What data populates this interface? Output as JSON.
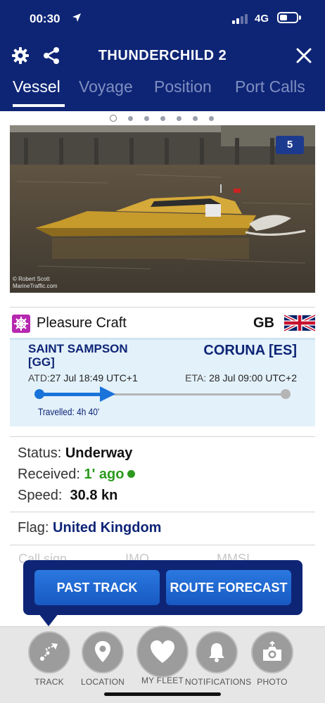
{
  "status_bar": {
    "time": "00:30",
    "network": "4G"
  },
  "header": {
    "title": "THUNDERCHILD 2",
    "tabs": [
      {
        "label": "Vessel",
        "active": true
      },
      {
        "label": "Voyage"
      },
      {
        "label": "Position"
      },
      {
        "label": "Port Calls"
      }
    ]
  },
  "gallery": {
    "photo_count": "5",
    "credit_line1": "© Robert Scott",
    "credit_line2": "MarineTraffic.com",
    "pages": 7,
    "current_page": 1
  },
  "vessel_type": {
    "label": "Pleasure Craft",
    "flag_code": "GB"
  },
  "route": {
    "from": "SAINT SAMPSON [GG]",
    "to": "CORUNA [ES]",
    "atd_label": "ATD:",
    "atd_value": "27 Jul 18:49 UTC+1",
    "eta_label": "ETA:",
    "eta_value": "28 Jul 09:00 UTC+2",
    "travelled": "Travelled: 4h 40'",
    "progress_fraction": 0.28
  },
  "info": {
    "status_label": "Status:",
    "status_value": "Underway",
    "received_label": "Received:",
    "received_value": "1' ago",
    "speed_label": "Speed:",
    "speed_value": "30.8 kn",
    "flag_label": "Flag:",
    "flag_value": "United Kingdom",
    "callsign_label": "Call sign",
    "imo_label": "IMO",
    "mmsi_label": "MMSI"
  },
  "popup": {
    "past_track": "PAST TRACK",
    "route_forecast": "ROUTE FORECAST"
  },
  "bottom_nav": [
    {
      "label": "TRACK",
      "icon": "track-icon"
    },
    {
      "label": "LOCATION",
      "icon": "location-pin-icon"
    },
    {
      "label": "MY FLEET",
      "icon": "heart-icon"
    },
    {
      "label": "NOTIFICATIONS",
      "icon": "bell-icon"
    },
    {
      "label": "PHOTO",
      "icon": "camera-icon"
    }
  ],
  "colors": {
    "navy": "#0e2576",
    "accent_blue": "#1a73d9",
    "green": "#2b9a1e",
    "type_magenta": "#b728b0"
  }
}
